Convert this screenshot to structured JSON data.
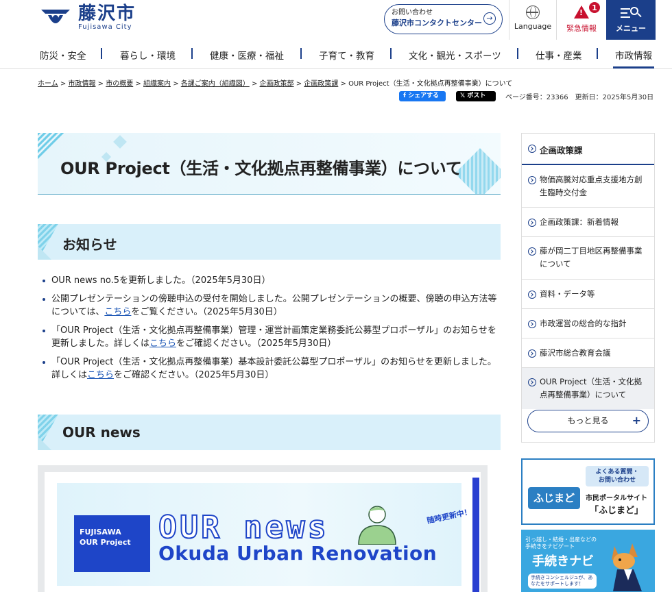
{
  "header": {
    "logo_jp": "藤沢市",
    "logo_en": "Fujisawa City",
    "contact_line1": "お問い合わせ",
    "contact_line2": "藤沢市コンタクトセンター",
    "language_label": "Language",
    "emergency_label": "緊急情報",
    "emergency_count": "1",
    "menu_label": "メニュー"
  },
  "nav": {
    "items": [
      "防災・安全",
      "暮らし・環境",
      "健康・医療・福祉",
      "子育て・教育",
      "文化・観光・スポーツ",
      "仕事・産業",
      "市政情報"
    ],
    "active_index": 6
  },
  "breadcrumb": {
    "items": [
      "ホーム",
      "市政情報",
      "市の概要",
      "組織案内",
      "各課ご案内（組織図）",
      "企画政策部",
      "企画政策課"
    ],
    "current": "OUR Project（生活・文化拠点再整備事業）について",
    "separator": ">"
  },
  "share": {
    "facebook": "シェアする",
    "x": "ポスト"
  },
  "page_info": "ページ番号：23366　更新日：2025年5月30日",
  "main": {
    "title": "OUR Project（生活・文化拠点再整備事業）について",
    "section1": "お知らせ",
    "section2": "OUR news",
    "news": [
      {
        "text_before": "OUR news no.5を更新しました。（2025年5月30日）"
      },
      {
        "text_before": "公開プレゼンテーションの傍聴申込の受付を開始しました。公開プレゼンテーションの概要、傍聴の申込方法等については、",
        "link": "こちら",
        "text_after": "をご覧ください。（2025年5月30日）"
      },
      {
        "text_before": "「OUR Project（生活・文化拠点再整備事業）管理・運営計画策定業務委託公募型プロポーザル」のお知らせを更新しました。詳しくは",
        "link": "こちら",
        "text_after": "をご確認ください。（2025年5月30日）"
      },
      {
        "text_before": "「OUR Project（生活・文化拠点再整備事業）基本設計委託公募型プロポーザル」のお知らせを更新しました。詳しくは",
        "link": "こちら",
        "text_after": "をご確認ください。（2025年5月30日）"
      }
    ],
    "banner": {
      "left_l1": "FUJISAWA",
      "left_l2": "OUR Project",
      "title": "OUR news",
      "subtitle": "Okuda Urban Renovation",
      "tag": "随時更新中！"
    }
  },
  "sidebar": {
    "head": "企画政策課",
    "items": [
      {
        "label_l1": "物価高騰対応重点支援地方創",
        "label_l2": "生臨時交付金"
      },
      {
        "label_l1": "企画政策課：新着情報"
      },
      {
        "label_l1": "藤が岡二丁目地区再整備事業",
        "label_l2": "について"
      },
      {
        "label_l1": "資料・データ等"
      },
      {
        "label_l1": "市政運営の総合的な指針"
      },
      {
        "label_l1": "藤沢市総合教育会議"
      },
      {
        "label_l1": "OUR Project（生活・文化拠",
        "label_l2": "点再整備事業）について"
      }
    ],
    "more": "もっと見る",
    "banner1": {
      "tag_l1": "よくある質問・",
      "tag_l2": "お問い合わせ",
      "logo": "ふじまど",
      "line1": "市民ポータルサイト",
      "line2": "「ふじまど」"
    },
    "banner2": {
      "line1": "引っ越し・結婚・出産などの",
      "line2": "手続きをナビゲート",
      "title": "手続きナビ",
      "note": "手続きコンシェルジュが、あなたをサポートします！"
    }
  },
  "colors": {
    "brand": "#1b3f8a",
    "accent": "#c8102e",
    "light": "#d9f0fa"
  }
}
